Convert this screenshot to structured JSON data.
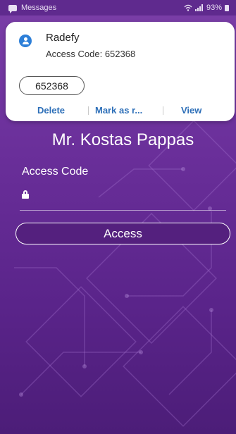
{
  "status_bar": {
    "app_name": "Messages",
    "battery": "93%",
    "icons": [
      "message-icon",
      "wifi-icon",
      "signal-icon",
      "battery-icon"
    ]
  },
  "notification": {
    "sender": "Radefy",
    "body": "Access Code: 652368",
    "code_chip": "652368",
    "actions": {
      "delete": "Delete",
      "mark_read": "Mark as r...",
      "view": "View"
    }
  },
  "app": {
    "user_name": "Mr. Kostas Pappas",
    "field_label": "Access Code",
    "access_value": "",
    "access_button": "Access"
  },
  "colors": {
    "background_top": "#7b3fa8",
    "background_bottom": "#4c1d78",
    "notification_action": "#2d6fb8",
    "avatar": "#2d7fd8"
  }
}
